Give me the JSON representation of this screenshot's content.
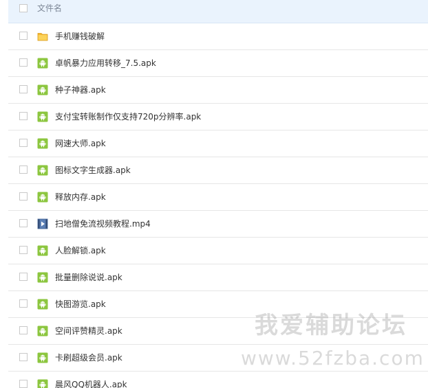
{
  "header": {
    "column_label": "文件名"
  },
  "files": [
    {
      "name": "手机赚钱破解",
      "type": "folder"
    },
    {
      "name": "卓帆暴力应用转移_7.5.apk",
      "type": "apk"
    },
    {
      "name": "种子神器.apk",
      "type": "apk"
    },
    {
      "name": "支付宝转账制作仅支持720p分辨率.apk",
      "type": "apk"
    },
    {
      "name": "网速大师.apk",
      "type": "apk"
    },
    {
      "name": "图标文字生成器.apk",
      "type": "apk"
    },
    {
      "name": "释放内存.apk",
      "type": "apk"
    },
    {
      "name": "扫地僧免流视频教程.mp4",
      "type": "video"
    },
    {
      "name": "人脸解锁.apk",
      "type": "apk"
    },
    {
      "name": "批量删除说说.apk",
      "type": "apk"
    },
    {
      "name": "快图游览.apk",
      "type": "apk"
    },
    {
      "name": "空间评赞精灵.apk",
      "type": "apk"
    },
    {
      "name": "卡刷超级会员.apk",
      "type": "apk"
    },
    {
      "name": "晨风QQ机器人.apk",
      "type": "apk"
    }
  ],
  "watermark": {
    "title": "我爱辅助论坛",
    "url": "www.52fzba.com"
  },
  "colors": {
    "header_bg": "#eaf3fd",
    "android_green": "#8cc63f",
    "folder_yellow": "#f5b731",
    "video_blue": "#5b7fb5"
  }
}
